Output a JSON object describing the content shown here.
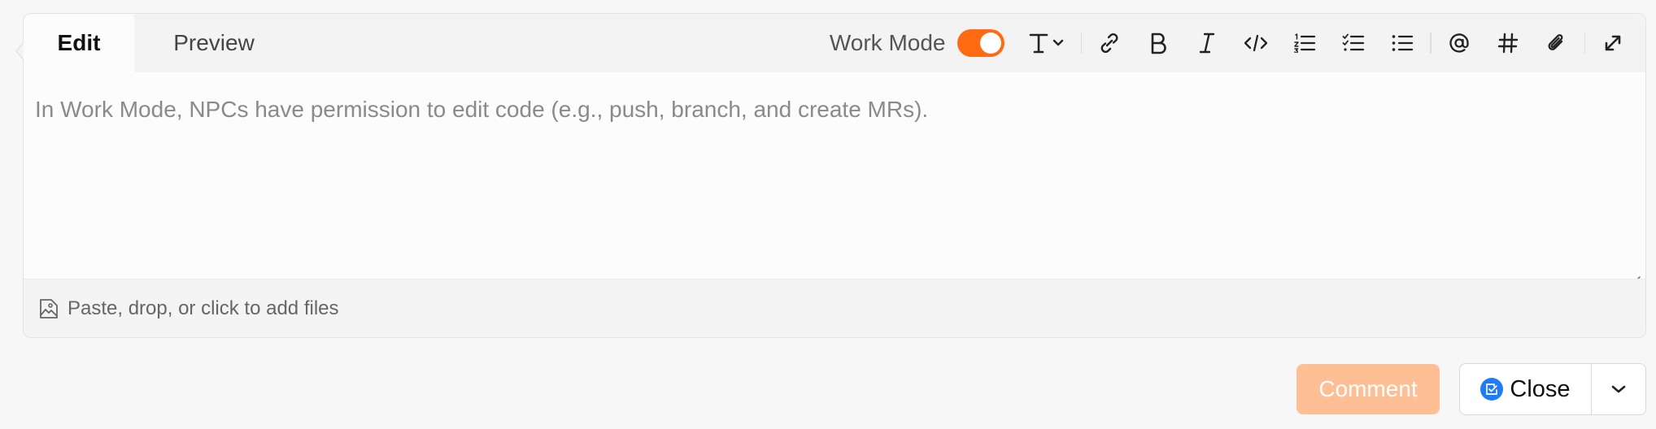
{
  "tabs": {
    "edit": "Edit",
    "preview": "Preview"
  },
  "toolbar": {
    "work_mode_label": "Work Mode",
    "work_mode_on": true,
    "icons": [
      "text-style-icon",
      "chevron-down-icon",
      "link-icon",
      "bold-icon",
      "italic-icon",
      "code-icon",
      "ordered-list-icon",
      "task-list-icon",
      "bullet-list-icon",
      "mention-icon",
      "hashtag-icon",
      "attachment-icon",
      "expand-icon"
    ]
  },
  "editor": {
    "placeholder": "In Work Mode, NPCs have permission to edit code (e.g., push, branch, and create MRs)."
  },
  "files": {
    "hint": "Paste, drop, or click to add files"
  },
  "actions": {
    "comment_label": "Comment",
    "close_label": "Close"
  },
  "colors": {
    "accent_orange": "#ff6b12",
    "comment_disabled": "#ffbf94",
    "status_blue": "#1f7cf5"
  }
}
